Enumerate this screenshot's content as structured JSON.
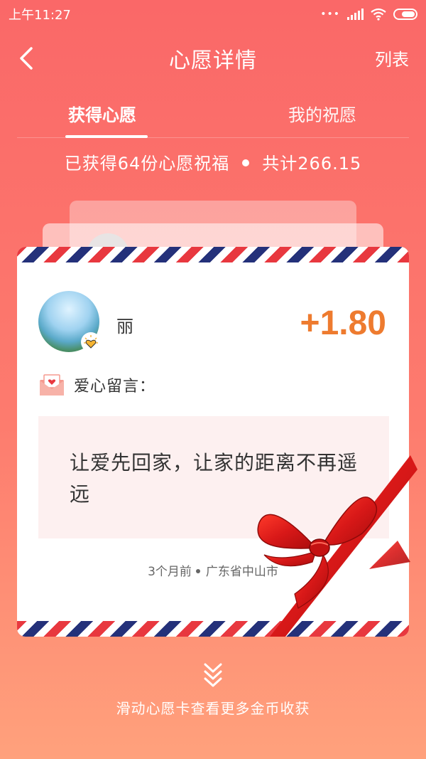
{
  "status_bar": {
    "time": "上午11:27",
    "dots": "•••"
  },
  "nav": {
    "title": "心愿详情",
    "right_label": "列表"
  },
  "tabs": [
    {
      "label": "获得心愿",
      "active": true
    },
    {
      "label": "我的祝愿",
      "active": false
    }
  ],
  "summary": {
    "received": "已获得64份心愿祝福",
    "total": "共计266.15"
  },
  "card": {
    "user_name": "丽",
    "amount": "+1.80",
    "message_label": "爱心留言：",
    "message": "让爱先回家，让家的距离不再遥远",
    "time_ago": "3个月前",
    "location": "广东省中山市"
  },
  "footer": {
    "hint": "滑动心愿卡查看更多金币收获"
  },
  "colors": {
    "accent": "#ee7b2f",
    "airmail_red": "#e8383f",
    "airmail_blue": "#24317a",
    "ribbon": "#d81818"
  }
}
